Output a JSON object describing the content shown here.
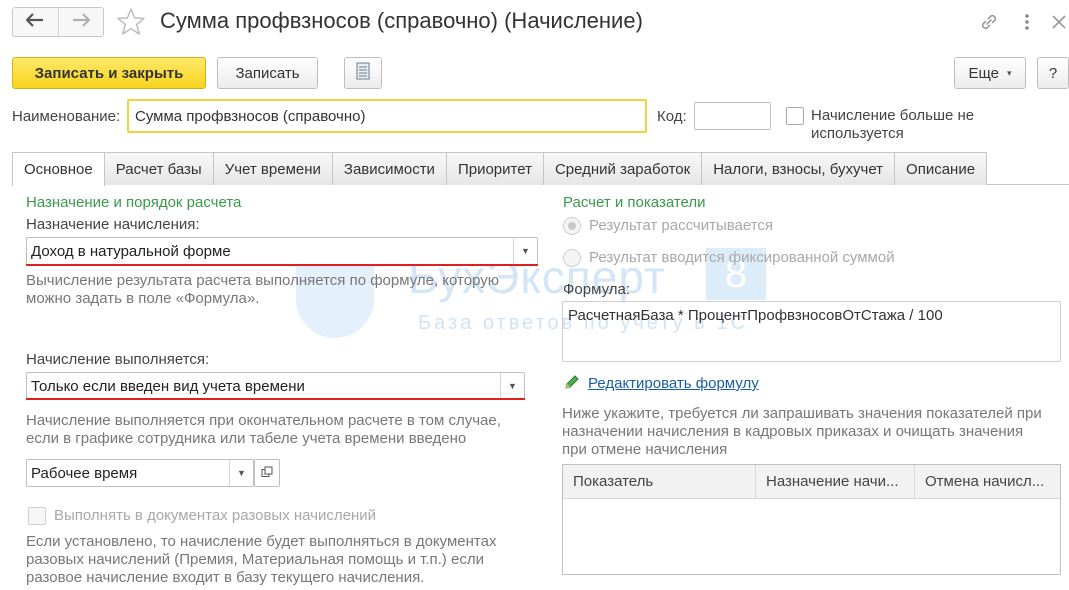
{
  "window": {
    "title": "Сумма профвзносов (справочно) (Начисление)"
  },
  "toolbar": {
    "save_close_label": "Записать и закрыть",
    "save_label": "Записать",
    "more_label": "Еще",
    "help_label": "?"
  },
  "header": {
    "name_label": "Наименование:",
    "name_value": "Сумма профвзносов (справочно)",
    "code_label": "Код:",
    "code_value": "",
    "not_used_label_line1": "Начисление больше не",
    "not_used_label_line2": "используется",
    "not_used_checked": false
  },
  "tabs": [
    {
      "label": "Основное",
      "active": true
    },
    {
      "label": "Расчет базы",
      "active": false
    },
    {
      "label": "Учет времени",
      "active": false
    },
    {
      "label": "Зависимости",
      "active": false
    },
    {
      "label": "Приоритет",
      "active": false
    },
    {
      "label": "Средний заработок",
      "active": false
    },
    {
      "label": "Налоги, взносы, бухучет",
      "active": false
    },
    {
      "label": "Описание",
      "active": false
    }
  ],
  "left": {
    "section_title": "Назначение и порядок расчета",
    "purpose_label": "Назначение начисления:",
    "purpose_value": "Доход в натуральной форме",
    "purpose_note_line1": "Вычисление результата расчета выполняется по формуле, которую",
    "purpose_note_line2": "можно задать в поле «Формула».",
    "performed_label": "Начисление выполняется:",
    "performed_value": "Только если введен вид учета времени",
    "performed_note_line1": "Начисление выполняется при окончательном расчете в том случае,",
    "performed_note_line2": "если в графике сотрудника или табеле учета времени введено",
    "time_type_value": "Рабочее время",
    "one_time_label": "Выполнять в документах разовых начислений",
    "one_time_note_line1": "Если установлено, то начисление будет выполняться в документах",
    "one_time_note_line2": "разовых начислений (Премия, Материальная помощь и т.п.) если",
    "one_time_note_line3": "разовое начисление входит в базу текущего начисления."
  },
  "right": {
    "section_title": "Расчет и показатели",
    "radio_calculated": "Результат рассчитывается",
    "radio_fixed": "Результат вводится фиксированной суммой",
    "formula_label": "Формула:",
    "formula_value": "РасчетнаяБаза * ПроцентПрофвзносовОтСтажа / 100",
    "edit_formula_link": "Редактировать формулу",
    "indicators_note_line1": "Ниже укажите, требуется ли запрашивать значения показателей при",
    "indicators_note_line2": "назначении начисления в кадровых приказах и очищать значения",
    "indicators_note_line3": "при отмене начисления",
    "grid_columns": [
      "Показатель",
      "Назначение начи...",
      "Отмена начисл..."
    ]
  },
  "watermark": {
    "title": "БухЭксперт",
    "badge": "8",
    "subtitle": "База ответов по учету в 1С"
  },
  "colors": {
    "primary_button": "#f8d31c",
    "section_green": "#3a9a4a",
    "link_blue": "#1a5ea8",
    "underline_red": "#e02020"
  }
}
